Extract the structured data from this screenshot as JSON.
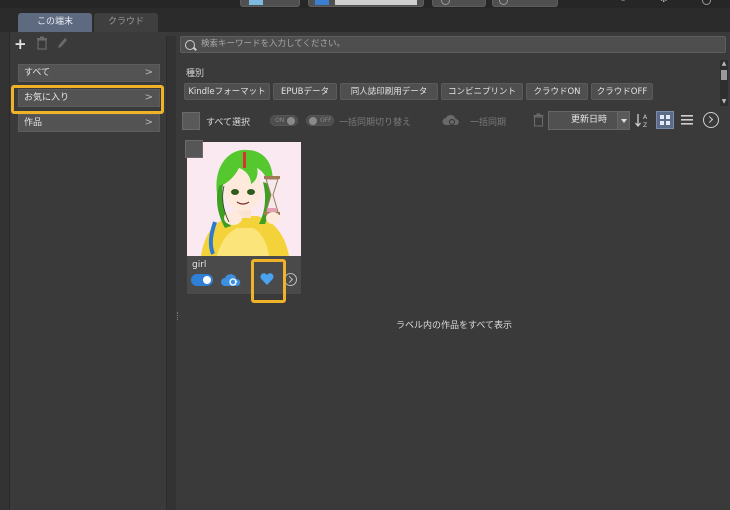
{
  "tabs": [
    {
      "label": "この端末",
      "active": true
    },
    {
      "label": "クラウド",
      "active": false
    }
  ],
  "sidebar": {
    "tools": [
      "plus-icon",
      "trash-icon",
      "pen-icon"
    ],
    "items": [
      {
        "label": "すべて"
      },
      {
        "label": "お気に入り",
        "highlighted": true
      },
      {
        "label": "作品"
      }
    ]
  },
  "search": {
    "placeholder": "検索キーワードを入力してください。"
  },
  "filter": {
    "type_label": "種別",
    "chips": [
      "Kindleフォーマット",
      "EPUBデータ",
      "同人誌印刷用データ",
      "コンビニプリント",
      "クラウドON",
      "クラウドOFF"
    ]
  },
  "toolbar": {
    "select_all_label": "すべて選択",
    "toggle_on_text": "ON",
    "toggle_off_text": "OFF",
    "bulk_sync_toggle_label": "一括同期切り替え",
    "bulk_sync_label": "一括同期",
    "sort_value": "更新日時"
  },
  "works": [
    {
      "title": "girl",
      "cloud_sync": true,
      "favorite": true
    }
  ],
  "show_all_in_label": "ラベル内の作品をすべて表示",
  "colors": {
    "accent_highlight": "#f0b229",
    "toggle_on": "#2e7fd6",
    "cloud": "#3d8fe0",
    "heart": "#4aa3f0",
    "active_tab": "#5d6a80"
  }
}
